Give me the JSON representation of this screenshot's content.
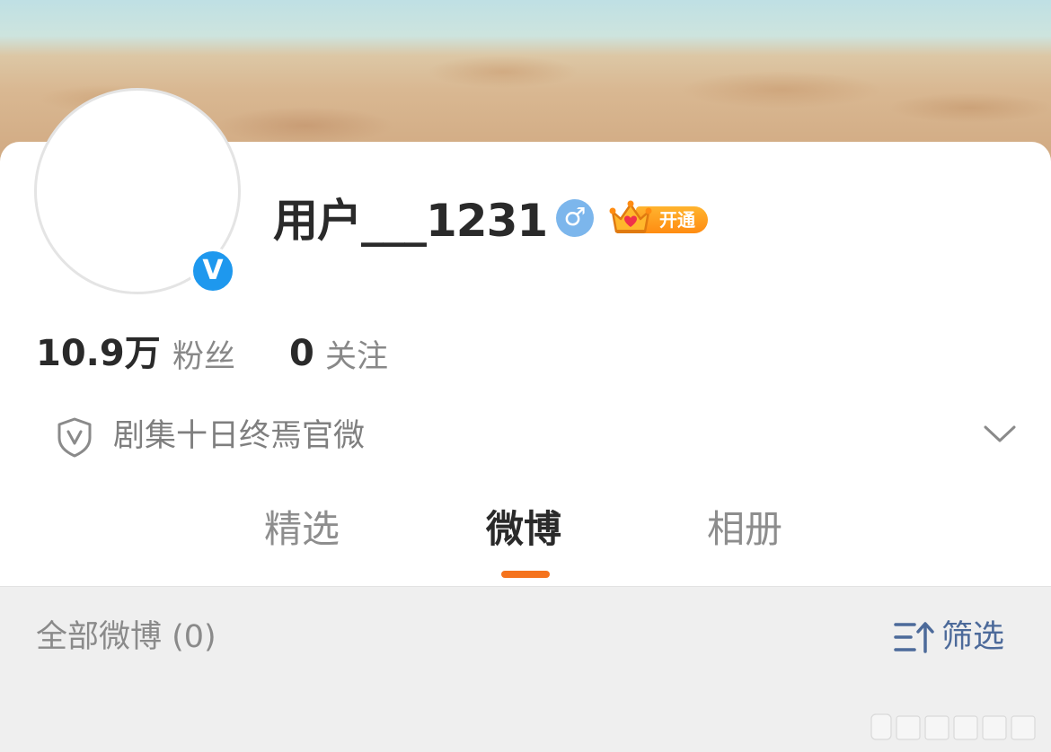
{
  "profile": {
    "username": "用户___1231",
    "verified_badge": "V",
    "gender_symbol": "♂",
    "vip_label": "开通",
    "icons": {
      "verified": "verified-v-icon",
      "gender": "male-icon",
      "vip": "crown-icon"
    },
    "colors": {
      "verified": "#1e98ee",
      "gender": "#7cb6ec",
      "vip": "#ff9a1f"
    }
  },
  "stats": {
    "followers_value": "10.9万",
    "followers_label": "粉丝",
    "following_value": "0",
    "following_label": "关注"
  },
  "verification": {
    "text": "剧集十日终焉官微",
    "icon": "shield-v-icon",
    "expand_icon": "chevron-down-icon"
  },
  "tabs": [
    {
      "label": "精选",
      "active": false
    },
    {
      "label": "微博",
      "active": true
    },
    {
      "label": "相册",
      "active": false
    }
  ],
  "accent_color": "#f5731d",
  "feed": {
    "header": "全部微博 (0)",
    "filter_label": "筛选",
    "filter_icon": "sort-filter-icon",
    "filter_color": "#4c6a9a"
  }
}
